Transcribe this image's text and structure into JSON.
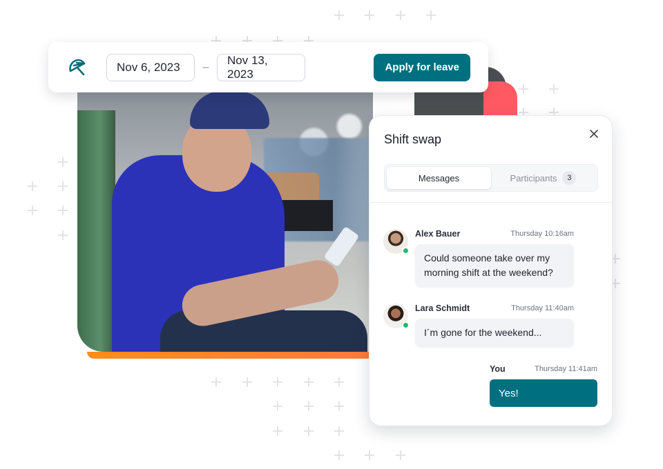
{
  "leave_bar": {
    "logo_icon": "umbrella-icon",
    "start_date": "Nov 6, 2023",
    "separator": "–",
    "end_date": "Nov 13, 2023",
    "apply_label": "Apply for leave",
    "accent_color": "#006f80"
  },
  "photo": {
    "description": "Smiling factory worker in hard hat and safety glasses holding a phone"
  },
  "chat": {
    "title": "Shift swap",
    "close_icon": "close-icon",
    "tabs": [
      {
        "label": "Messages",
        "active": true
      },
      {
        "label": "Participants",
        "active": false,
        "count": "3"
      }
    ],
    "messages": [
      {
        "sender": "Alex Bauer",
        "time": "Thursday 10:16am",
        "text": "Could someone take over my morning shift at the weekend?",
        "online": true
      },
      {
        "sender": "Lara Schmidt",
        "time": "Thursday 11:40am",
        "text": "I´m gone for the weekend...",
        "online": true
      }
    ],
    "own_message": {
      "sender": "You",
      "time": "Thursday 11:41am",
      "text": "Yes!"
    }
  },
  "colors": {
    "primary": "#006f80",
    "online": "#1fbe6b",
    "orange_accent": "#ff8c1a",
    "coral_accent": "#ff5a64"
  }
}
